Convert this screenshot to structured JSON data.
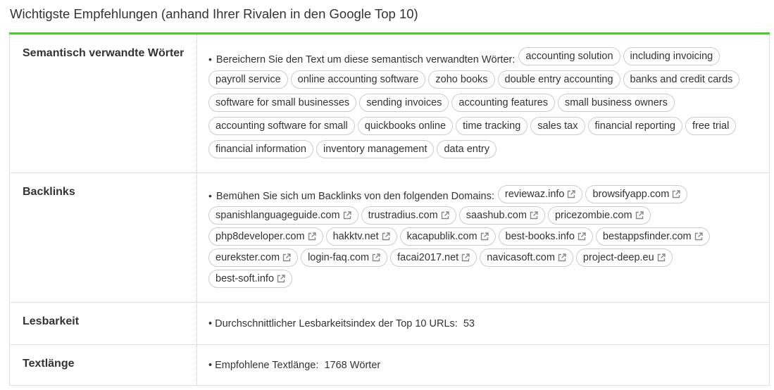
{
  "page_title": "Wichtigste Empfehlungen (anhand Ihrer Rivalen in den Google Top 10)",
  "colors": {
    "accent_bar": "#5dbb46",
    "border": "#e1e1e1",
    "tag_border": "#cccccc"
  },
  "rows": {
    "semantic": {
      "label": "Semantisch verwandte Wörter",
      "intro": "Bereichern Sie den Text um diese semantisch verwandten Wörter:",
      "tags": [
        "accounting solution",
        "including invoicing",
        "payroll service",
        "online accounting software",
        "zoho books",
        "double entry accounting",
        "banks and credit cards",
        "software for small businesses",
        "sending invoices",
        "accounting features",
        "small business owners",
        "accounting software for small",
        "quickbooks online",
        "time tracking",
        "sales tax",
        "financial reporting",
        "free trial",
        "financial information",
        "inventory management",
        "data entry"
      ]
    },
    "backlinks": {
      "label": "Backlinks",
      "intro": "Bemühen Sie sich um Backlinks von den folgenden Domains:",
      "domains": [
        "reviewaz.info",
        "browsifyapp.com",
        "spanishlanguageguide.com",
        "trustradius.com",
        "saashub.com",
        "pricezombie.com",
        "php8developer.com",
        "hakktv.net",
        "kacapublik.com",
        "best-books.info",
        "bestappsfinder.com",
        "eurekster.com",
        "login-faq.com",
        "facai2017.net",
        "navicasoft.com",
        "project-deep.eu",
        "best-soft.info"
      ],
      "link_icon": "external-link-icon"
    },
    "readability": {
      "label": "Lesbarkeit",
      "text": "Durchschnittlicher Lesbarkeitsindex der Top 10 URLs:",
      "value": "53"
    },
    "length": {
      "label": "Textlänge",
      "text": "Empfohlene Textlänge:",
      "value": "1768 Wörter"
    }
  }
}
